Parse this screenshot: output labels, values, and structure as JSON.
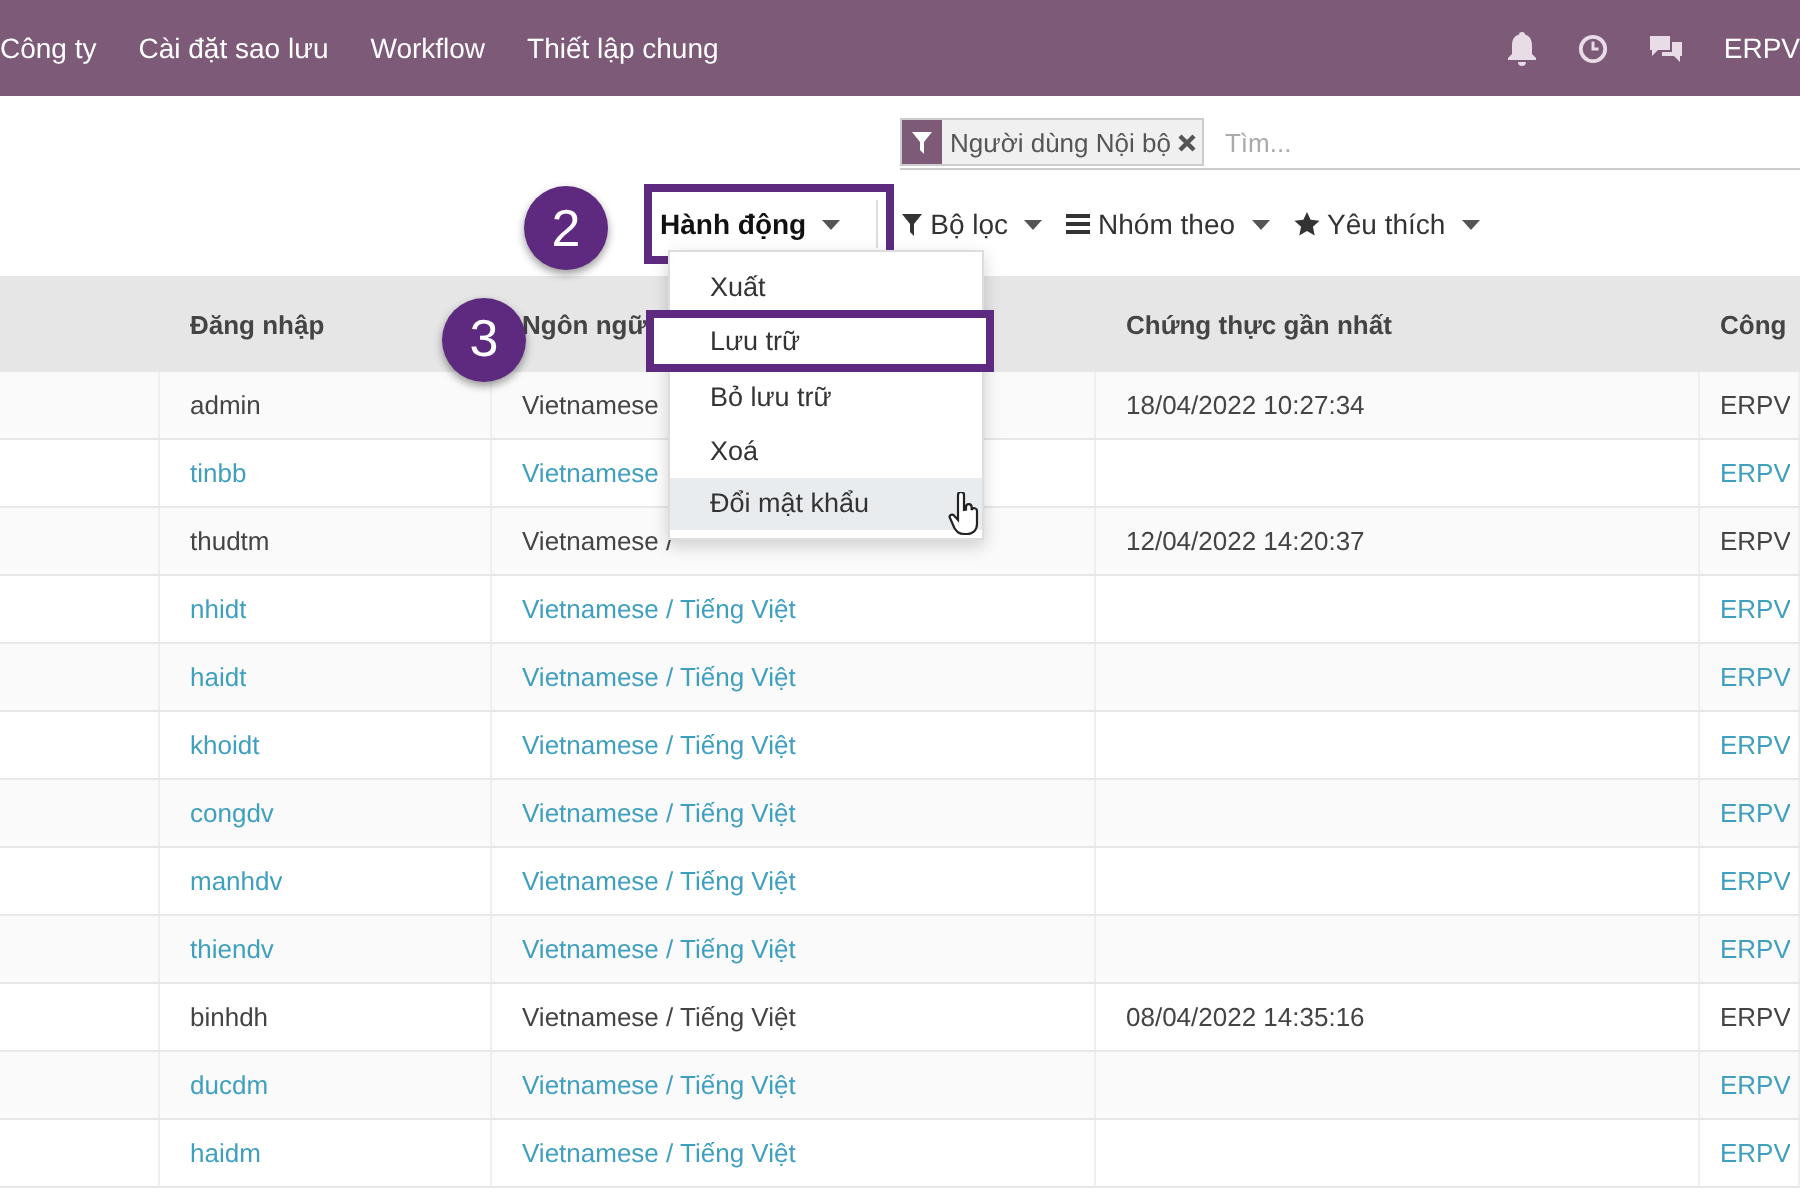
{
  "navbar": {
    "menu": [
      "Công ty",
      "Cài đặt sao lưu",
      "Workflow",
      "Thiết lập chung"
    ],
    "user": "ERPV"
  },
  "search": {
    "facets": [
      {
        "label": "Người dùng Nội bộ"
      }
    ],
    "placeholder": "Tìm..."
  },
  "toolbar": [
    {
      "label": "Hành động",
      "kind": "action",
      "expanded": true,
      "annotation": "2"
    },
    {
      "label": "Bộ lọc",
      "kind": "filter",
      "expanded": false
    },
    {
      "label": "Nhóm theo",
      "kind": "group",
      "expanded": false
    },
    {
      "label": "Yêu thích",
      "kind": "favorite",
      "expanded": false
    }
  ],
  "dropdown": {
    "items": [
      {
        "label": "Xuất",
        "hovered": false
      },
      {
        "label": "Lưu trữ",
        "hovered": false,
        "annotation": "3"
      },
      {
        "label": "Bỏ lưu trữ",
        "hovered": false
      },
      {
        "label": "Xoá",
        "hovered": false
      },
      {
        "label": "Đổi mật khẩu",
        "hovered": true
      }
    ]
  },
  "table": {
    "columns": [
      "Đăng nhập",
      "Ngôn ngữ",
      "Chứng thực gần nhất",
      "Công"
    ],
    "rows": [
      {
        "new_user": false,
        "login": "admin",
        "language": "Vietnamese",
        "last_auth": "18/04/2022 10:27:34",
        "company": "ERPV"
      },
      {
        "new_user": true,
        "login": "tinbb",
        "language": "Vietnamese",
        "company": "ERPV"
      },
      {
        "new_user": false,
        "login": "thudtm",
        "language": "Vietnamese /",
        "last_auth": "12/04/2022 14:20:37",
        "company": "ERPV"
      },
      {
        "new_user": true,
        "login": "nhidt",
        "language": "Vietnamese / Tiếng Việt",
        "company": "ERPV"
      },
      {
        "new_user": true,
        "login": "haidt",
        "language": "Vietnamese / Tiếng Việt",
        "company": "ERPV"
      },
      {
        "new_user": true,
        "login": "khoidt",
        "language": "Vietnamese / Tiếng Việt",
        "company": "ERPV"
      },
      {
        "new_user": true,
        "login": "congdv",
        "language": "Vietnamese / Tiếng Việt",
        "company": "ERPV"
      },
      {
        "new_user": true,
        "login": "manhdv",
        "language": "Vietnamese / Tiếng Việt",
        "company": "ERPV"
      },
      {
        "new_user": true,
        "login": "thiendv",
        "language": "Vietnamese / Tiếng Việt",
        "company": "ERPV"
      },
      {
        "new_user": false,
        "login": "binhdh",
        "language": "Vietnamese / Tiếng Việt",
        "last_auth": "08/04/2022 14:35:16",
        "company": "ERPV"
      },
      {
        "new_user": true,
        "login": "ducdm",
        "language": "Vietnamese / Tiếng Việt",
        "company": "ERPV"
      },
      {
        "new_user": true,
        "login": "haidm",
        "language": "Vietnamese / Tiếng Việt",
        "company": "ERPV"
      }
    ]
  }
}
